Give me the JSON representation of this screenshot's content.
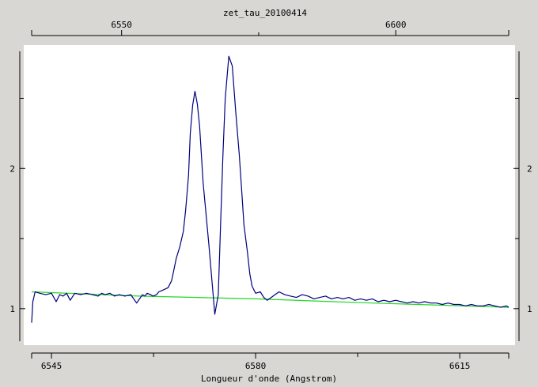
{
  "chart_data": {
    "type": "line",
    "title": "zet_tau_20100414",
    "xlabel": "Longueur d'onde (Angstrom)",
    "ylabel": "",
    "xlim": [
      6541.6,
      6623.4
    ],
    "ylim": [
      0.74,
      2.88
    ],
    "top_axis": {
      "xlim": [
        6533.6,
        6620.6
      ],
      "ticks": [
        6550,
        6600
      ],
      "minor_ticks": [
        6525,
        6575
      ],
      "tick_labels": [
        "6550",
        "6600"
      ]
    },
    "bottom_axis": {
      "ticks": [
        6545,
        6580,
        6615
      ],
      "minor_ticks": [
        6527.5,
        6562.5,
        6597.5
      ],
      "tick_labels": [
        "6545",
        "6580",
        "6615"
      ]
    },
    "y_ticks": [
      1,
      2
    ],
    "y_minor_ticks": [
      1.5,
      2.5
    ],
    "y_tick_labels": [
      "1",
      "2"
    ],
    "grid": false,
    "background": "#ffffff",
    "series": [
      {
        "color": "#000080",
        "x": [
          6541.6,
          6541.8,
          6542.2,
          6543,
          6544,
          6545,
          6545.8,
          6546.4,
          6547,
          6547.6,
          6548.2,
          6549,
          6550,
          6551,
          6552,
          6553,
          6553.6,
          6554.2,
          6555,
          6555.8,
          6556.6,
          6557.6,
          6558.6,
          6559.6,
          6560.6,
          6561,
          6561.4,
          6562,
          6562.4,
          6563,
          6563.4,
          6564,
          6565,
          6565.6,
          6566,
          6566.4,
          6567,
          6567.6,
          6568,
          6568.5,
          6568.8,
          6569.2,
          6569.6,
          6570,
          6570.4,
          6571,
          6572,
          6573,
          6573.6,
          6574,
          6574.4,
          6574.8,
          6575.4,
          6576,
          6576.6,
          6577.2,
          6577.6,
          6578,
          6578.6,
          6579,
          6579.4,
          6580,
          6580.8,
          6581.4,
          6582,
          6583,
          6584,
          6585,
          6586,
          6587,
          6588,
          6589,
          6590,
          6591,
          6592,
          6593,
          6594,
          6595,
          6596,
          6597,
          6598,
          6599,
          6600,
          6601,
          6602,
          6603,
          6604,
          6605,
          6606,
          6607,
          6608,
          6609,
          6610,
          6611,
          6612,
          6613,
          6614,
          6615,
          6616,
          6617,
          6618,
          6619,
          6620,
          6621,
          6622,
          6623,
          6623.4
        ],
        "y": [
          0.9,
          1.05,
          1.12,
          1.11,
          1.1,
          1.11,
          1.05,
          1.1,
          1.09,
          1.11,
          1.06,
          1.11,
          1.1,
          1.11,
          1.1,
          1.09,
          1.11,
          1.1,
          1.11,
          1.09,
          1.1,
          1.09,
          1.1,
          1.04,
          1.1,
          1.09,
          1.11,
          1.1,
          1.09,
          1.1,
          1.12,
          1.13,
          1.15,
          1.2,
          1.28,
          1.36,
          1.44,
          1.55,
          1.7,
          1.95,
          2.25,
          2.45,
          2.55,
          2.46,
          2.3,
          1.9,
          1.45,
          0.96,
          1.1,
          1.6,
          2.1,
          2.5,
          2.8,
          2.73,
          2.4,
          2.1,
          1.85,
          1.6,
          1.4,
          1.25,
          1.16,
          1.11,
          1.12,
          1.08,
          1.06,
          1.09,
          1.12,
          1.1,
          1.09,
          1.08,
          1.1,
          1.09,
          1.07,
          1.08,
          1.09,
          1.07,
          1.08,
          1.07,
          1.08,
          1.06,
          1.07,
          1.06,
          1.07,
          1.05,
          1.06,
          1.05,
          1.06,
          1.05,
          1.04,
          1.05,
          1.04,
          1.05,
          1.04,
          1.04,
          1.03,
          1.04,
          1.03,
          1.03,
          1.02,
          1.03,
          1.02,
          1.02,
          1.03,
          1.02,
          1.01,
          1.02,
          1.01
        ]
      },
      {
        "color": "#22d822",
        "x": [
          6541.6,
          6560,
          6580,
          6600,
          6623.4
        ],
        "y": [
          1.12,
          1.09,
          1.07,
          1.04,
          1.01
        ]
      }
    ]
  }
}
